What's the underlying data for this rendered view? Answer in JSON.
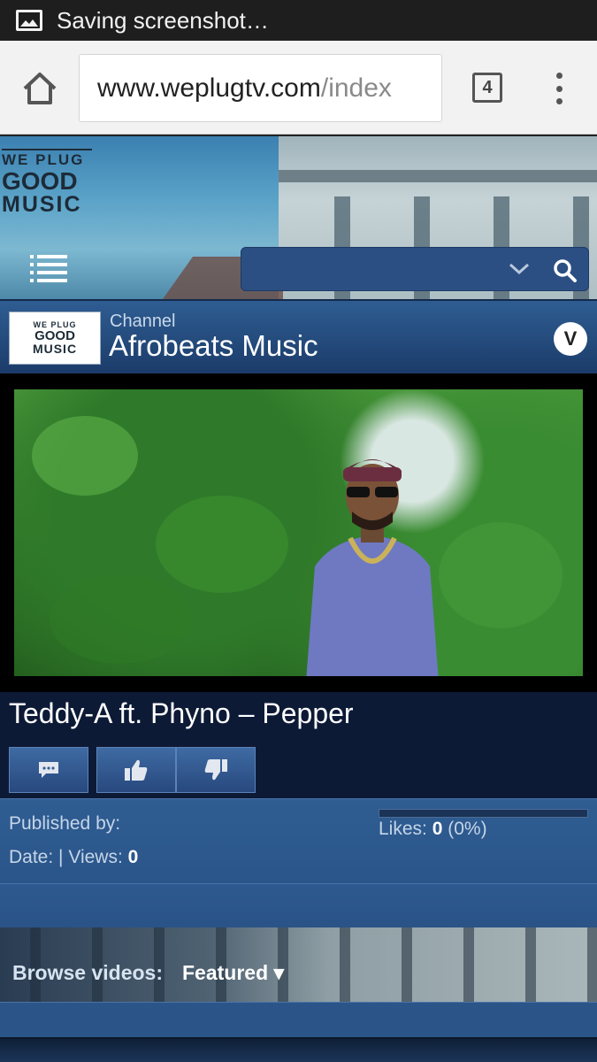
{
  "status_bar": {
    "text": "Saving screenshot…",
    "icon": "image-icon"
  },
  "browser": {
    "url_domain": "www.weplugtv.com",
    "url_path": "/index",
    "tab_count": "4"
  },
  "site": {
    "logo_line1": "WE PLUG",
    "logo_line2": "GOOD",
    "logo_line3": "MUSIC"
  },
  "channel": {
    "kicker": "Channel",
    "name": "Afrobeats Music",
    "toggle_label": "V"
  },
  "video": {
    "title": "Teddy-A ft. Phyno – Pepper"
  },
  "info": {
    "published_label": "Published by:",
    "date_label": "Date: | Views: ",
    "views": "0",
    "likes_label": "Likes: ",
    "likes": "0",
    "likes_pct": " (0%)",
    "likes_fraction": 0
  },
  "browse": {
    "label": "Browse videos:",
    "selected": "Featured ▾"
  },
  "colors": {
    "accent": "#2f5d92",
    "dark": "#0d1a36"
  }
}
